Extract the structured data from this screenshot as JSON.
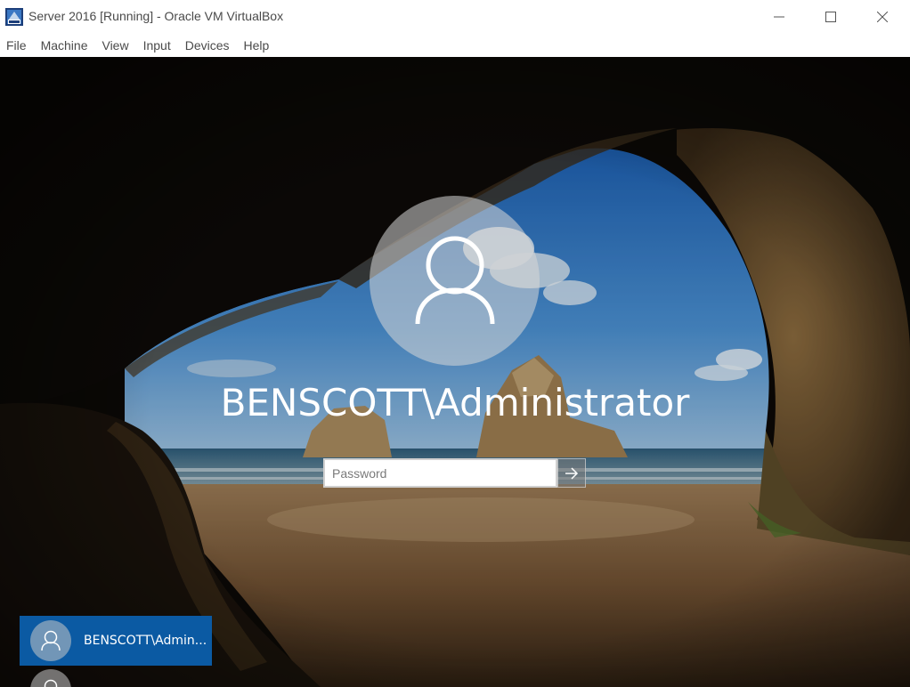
{
  "window": {
    "title": "Server 2016 [Running] - Oracle VM VirtualBox",
    "icon": "virtualbox-icon",
    "controls": {
      "minimize": "minimize-icon",
      "maximize": "maximize-icon",
      "close": "close-icon"
    }
  },
  "menu": {
    "items": [
      {
        "label": "File"
      },
      {
        "label": "Machine"
      },
      {
        "label": "View"
      },
      {
        "label": "Input"
      },
      {
        "label": "Devices"
      },
      {
        "label": "Help"
      }
    ]
  },
  "login": {
    "username": "BENSCOTT\\Administrator",
    "password_placeholder": "Password",
    "password_value": "",
    "submit_icon": "arrow-right-icon",
    "accent_color": "#0b5aa3"
  },
  "user_list": [
    {
      "name": "BENSCOTT\\Admin...",
      "selected": true
    },
    {
      "name": "",
      "selected": false
    }
  ]
}
